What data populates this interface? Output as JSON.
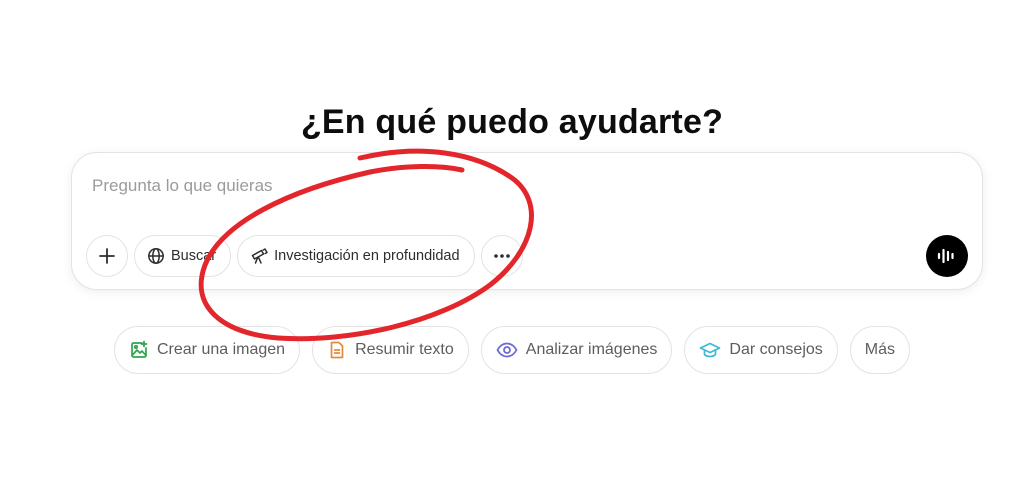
{
  "heading": "¿En qué puedo ayudarte?",
  "composer": {
    "placeholder": "Pregunta lo que quieras",
    "value": "",
    "tools": {
      "search_label": "Buscar",
      "research_label": "Investigación en profundidad"
    }
  },
  "suggestions": [
    {
      "label": "Crear una imagen",
      "icon": "image-icon",
      "color": "#2ea44f"
    },
    {
      "label": "Resumir texto",
      "icon": "document-icon",
      "color": "#e38b3c"
    },
    {
      "label": "Analizar imágenes",
      "icon": "eye-icon",
      "color": "#6b6bd6"
    },
    {
      "label": "Dar consejos",
      "icon": "graduation-cap-icon",
      "color": "#3fb7d9"
    },
    {
      "label": "Más",
      "icon": "",
      "color": ""
    }
  ],
  "colors": {
    "annotation_red": "#e3262b",
    "voice_button": "#000000",
    "border": "#e3e3e3"
  }
}
